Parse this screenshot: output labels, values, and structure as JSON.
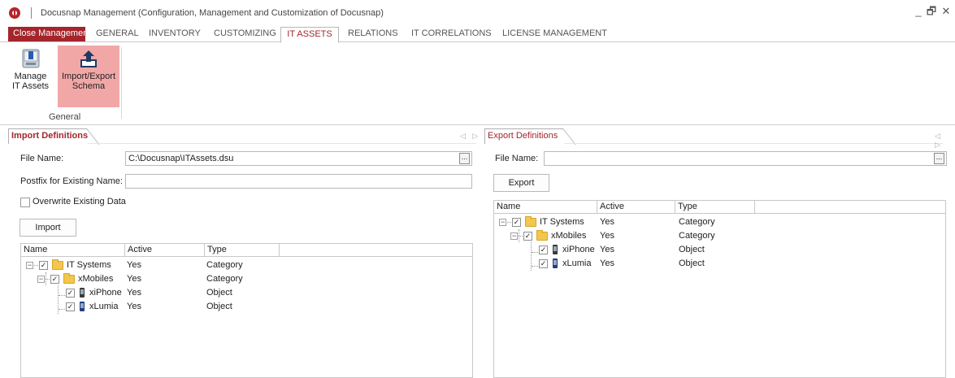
{
  "window": {
    "title": "Docusnap Management (Configuration, Management and Customization of Docusnap)",
    "controls": {
      "minimize": "_",
      "restore": "🗗",
      "close": "✕"
    }
  },
  "tabs": [
    {
      "label": "Close Management"
    },
    {
      "label": "GENERAL"
    },
    {
      "label": "INVENTORY"
    },
    {
      "label": "CUSTOMIZING"
    },
    {
      "label": "IT ASSETS"
    },
    {
      "label": "RELATIONS"
    },
    {
      "label": "IT CORRELATIONS"
    },
    {
      "label": "LICENSE MANAGEMENT"
    }
  ],
  "ribbon": {
    "manage_line1": "Manage",
    "manage_line2": "IT Assets",
    "import_line1": "Import/Export",
    "import_line2": "Schema",
    "group_label": "General"
  },
  "import_panel": {
    "tab_label": "Import Definitions",
    "file_name_label": "File Name:",
    "file_name_value": "C:\\Docusnap\\ITAssets.dsu",
    "postfix_label": "Postfix for Existing Name:",
    "postfix_value": "",
    "overwrite_label": "Overwrite Existing Data",
    "import_button": "Import",
    "browse_label": "...",
    "columns": [
      "Name",
      "Active",
      "Type"
    ],
    "rows": [
      {
        "name": "IT Systems",
        "active": "Yes",
        "type": "Category"
      },
      {
        "name": "xMobiles",
        "active": "Yes",
        "type": "Category"
      },
      {
        "name": "xiPhone",
        "active": "Yes",
        "type": "Object"
      },
      {
        "name": "xLumia",
        "active": "Yes",
        "type": "Object"
      }
    ]
  },
  "export_panel": {
    "tab_label": "Export Definitions",
    "file_name_label": "File Name:",
    "file_name_value": "",
    "export_button": "Export",
    "browse_label": "...",
    "columns": [
      "Name",
      "Active",
      "Type"
    ],
    "rows": [
      {
        "name": "IT Systems",
        "active": "Yes",
        "type": "Category"
      },
      {
        "name": "xMobiles",
        "active": "Yes",
        "type": "Category"
      },
      {
        "name": "xiPhone",
        "active": "Yes",
        "type": "Object"
      },
      {
        "name": "xLumia",
        "active": "Yes",
        "type": "Object"
      }
    ]
  },
  "panel_arrows": "◁ ▷",
  "check_mark": "✓",
  "expander_minus": "−",
  "accent_color": "#a4252b"
}
